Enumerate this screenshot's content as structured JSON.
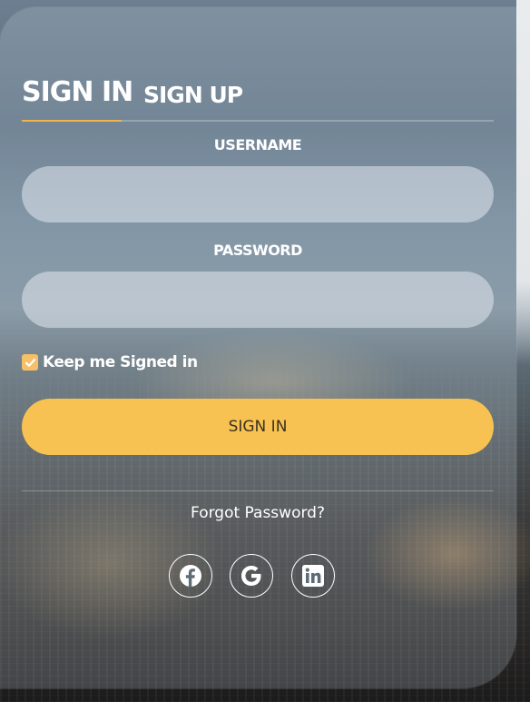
{
  "tabs": {
    "signin": "SIGN IN",
    "signup": "SIGN UP"
  },
  "form": {
    "username_label": "USERNAME",
    "password_label": "PASSWORD",
    "username_value": "",
    "password_value": "",
    "keep_signed_in_label": "Keep me Signed in",
    "keep_signed_in_checked": true,
    "submit_label": "SIGN IN",
    "forgot_password": "Forgot Password?"
  },
  "social": [
    {
      "name": "facebook-icon"
    },
    {
      "name": "google-icon"
    },
    {
      "name": "linkedin-icon"
    }
  ],
  "colors": {
    "accent": "#f7c251",
    "tab_underline": "#f0b24a",
    "text": "#ffffff"
  }
}
